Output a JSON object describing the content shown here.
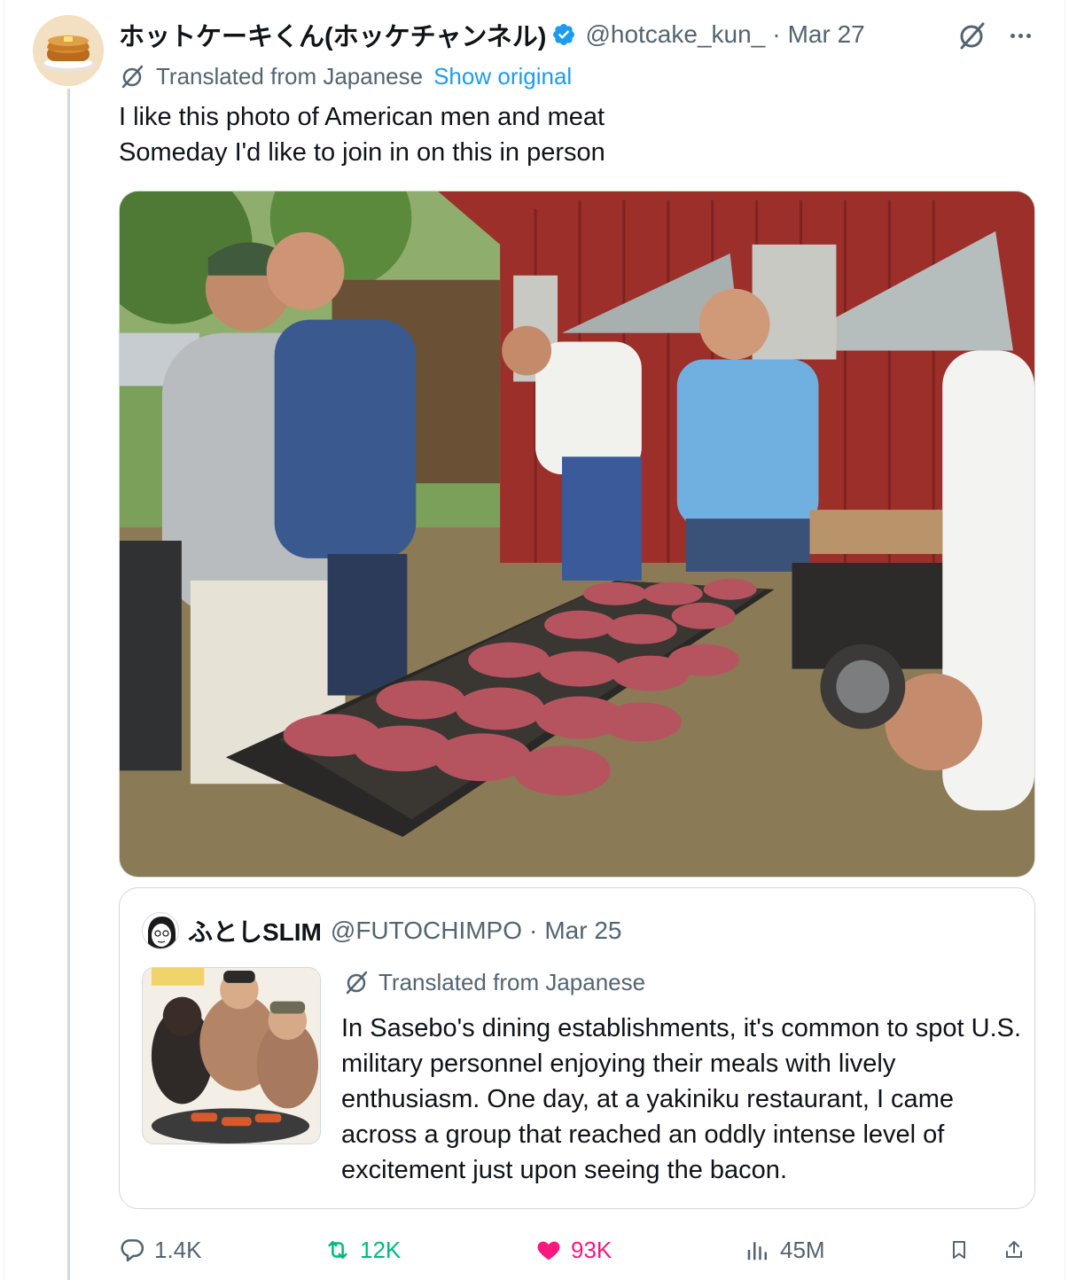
{
  "tweet": {
    "author": {
      "display_name": "ホットケーキくん(ホッケチャンネル)",
      "handle": "@hotcake_kun_",
      "verified": true,
      "avatar_icon": "pancake-avatar"
    },
    "separator": "·",
    "date": "Mar 27",
    "translated_label": "Translated from Japanese",
    "show_original_label": "Show original",
    "text_lines": [
      "I like this photo of American men and meat",
      "Someday I'd like to join in on this in person"
    ],
    "media_icon": "bbq-grill-photo"
  },
  "quoted_tweet": {
    "author": {
      "display_name": "ふとしSLIM",
      "handle": "@FUTOCHIMPO",
      "avatar_icon": "manga-face-avatar"
    },
    "separator": "·",
    "date": "Mar 25",
    "translated_label": "Translated from Japanese",
    "text": "In Sasebo's dining establishments, it's common to spot U.S. military personnel enjoying their meals with lively enthusiasm. One day, at a yakiniku restaurant, I came across a group that reached an oddly intense level of excitement just upon seeing the bacon.",
    "thumbnail_icon": "manga-yakiniku-illustration"
  },
  "actions": {
    "replies": "1.4K",
    "reposts": "12K",
    "likes": "93K",
    "views": "45M"
  },
  "colors": {
    "accent": "#1d9bf0",
    "repost": "#00ba7c",
    "like": "#f91880",
    "muted": "#536471",
    "text": "#0f1419",
    "border": "#cfd9de"
  }
}
